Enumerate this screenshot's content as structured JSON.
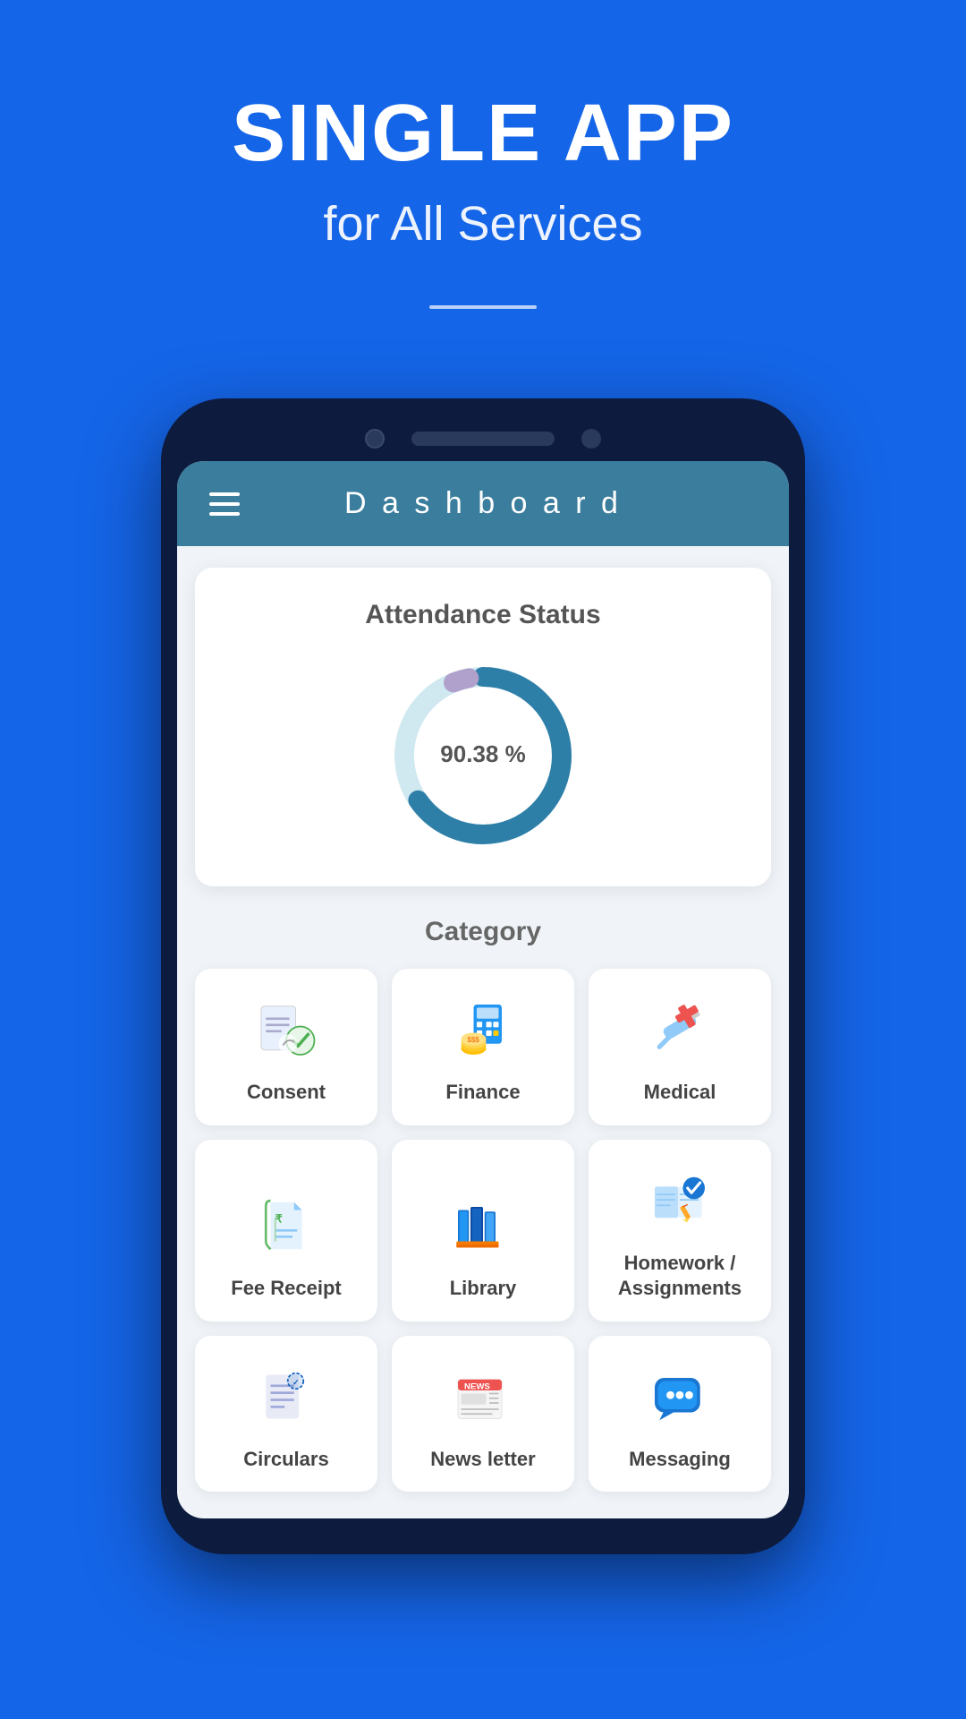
{
  "hero": {
    "title": "SINGLE APP",
    "subtitle": "for All Services"
  },
  "dashboard": {
    "title": "D a s h b o a r d",
    "attendance": {
      "label": "Attendance Status",
      "percentage": "90.38 %",
      "value": 90.38,
      "color": "#2e7fa8",
      "track_color": "#d0e8f0"
    },
    "category": {
      "label": "Category",
      "items": [
        {
          "id": "consent",
          "label": "Consent"
        },
        {
          "id": "finance",
          "label": "Finance"
        },
        {
          "id": "medical",
          "label": "Medical"
        },
        {
          "id": "fee-receipt",
          "label": "Fee Receipt"
        },
        {
          "id": "library",
          "label": "Library"
        },
        {
          "id": "homework",
          "label": "Homework / Assignments"
        },
        {
          "id": "circulars",
          "label": "Circulars"
        },
        {
          "id": "newsletter",
          "label": "News letter"
        },
        {
          "id": "messaging",
          "label": "Messaging"
        }
      ]
    }
  }
}
